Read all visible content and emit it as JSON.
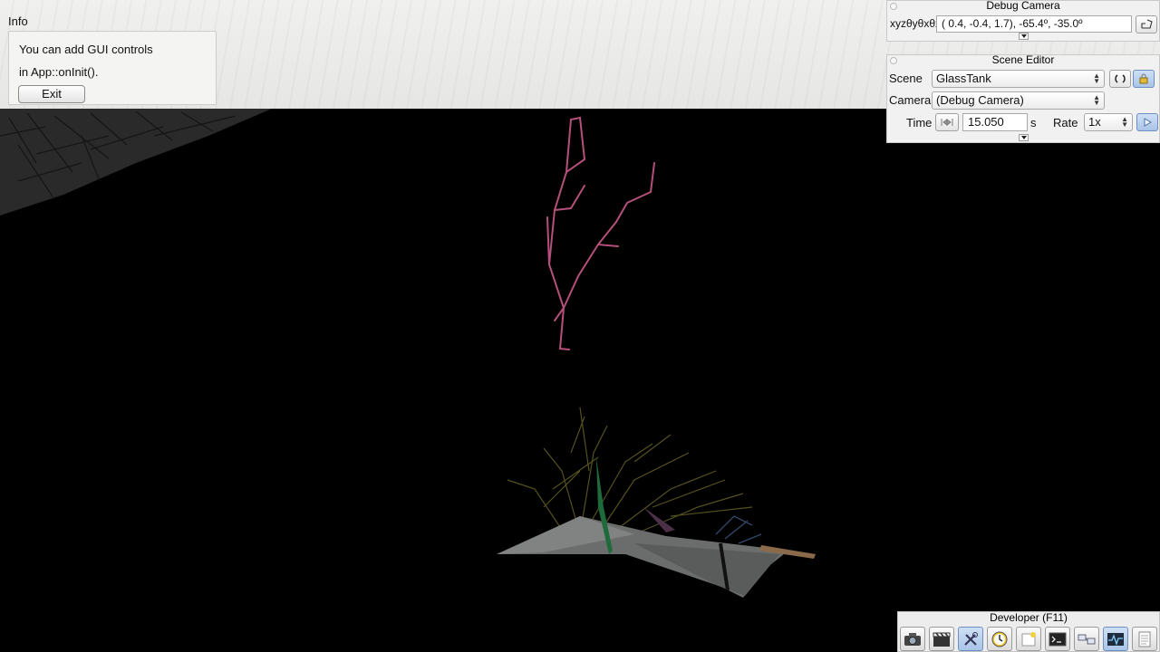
{
  "info_panel": {
    "title": "Info",
    "line1": "You can add GUI controls",
    "line2": "in App::onInit().",
    "exit_label": "Exit"
  },
  "debug_camera": {
    "title": "Debug Camera",
    "label": "xyzθyθxθz",
    "value": "(  0.4,  -0.4,   1.7), -65.4º, -35.0º"
  },
  "scene_editor": {
    "title": "Scene Editor",
    "scene_label": "Scene",
    "scene_value": "GlassTank",
    "camera_label": "Camera",
    "camera_value": "(Debug Camera)",
    "time_label": "Time",
    "time_value": "15.050",
    "time_unit": "s",
    "rate_label": "Rate",
    "rate_value": "1x"
  },
  "developer_dock": {
    "title": "Developer (F11)",
    "buttons": [
      "camera-icon",
      "clapperboard-icon",
      "tools-icon",
      "clock-icon",
      "note-icon",
      "terminal-icon",
      "scene-graph-icon",
      "profiler-icon",
      "document-icon"
    ]
  },
  "colors": {
    "panel_bg": "#f1f1f1",
    "viewport_bg": "#000000",
    "accent_blue": "#a9c4e8",
    "coral_pink": "#b4507a"
  }
}
